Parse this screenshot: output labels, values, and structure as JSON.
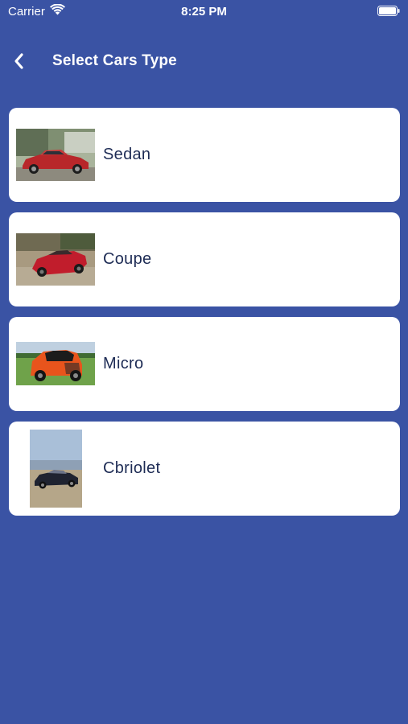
{
  "status_bar": {
    "carrier": "Carrier",
    "time": "8:25 PM"
  },
  "header": {
    "title": "Select Cars Type",
    "back_icon": "chevron-left-icon"
  },
  "car_types": [
    {
      "label": "Sedan"
    },
    {
      "label": "Coupe"
    },
    {
      "label": "Micro"
    },
    {
      "label": "Cbriolet"
    }
  ],
  "colors": {
    "background": "#3a53a4",
    "card": "#ffffff",
    "label_text": "#1e2c55"
  }
}
